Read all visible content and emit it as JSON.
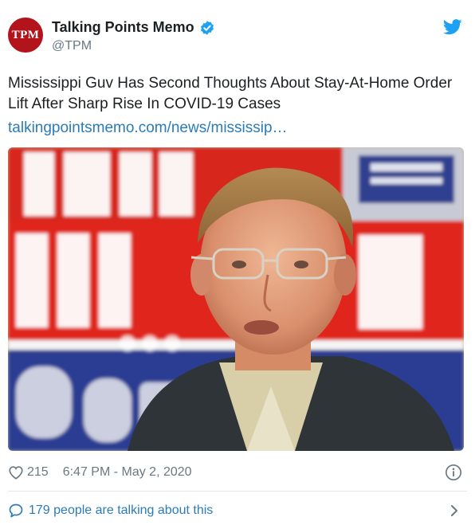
{
  "tweet": {
    "author": {
      "display_name": "Talking Points Memo",
      "handle": "@TPM",
      "avatar_text": "TPM",
      "verified": true
    },
    "text": "Mississippi Guv Has Second Thoughts About Stay-At-Home Order Lift After Sharp Rise In COVID-19 Cases",
    "link": "talkingpointsmemo.com/news/mississip…",
    "likes": "215",
    "timestamp": "6:47 PM - May 2, 2020",
    "conversation": "179 people are talking about this"
  },
  "icons": {
    "logo": "twitter-bird-icon",
    "verified": "verified-badge-icon",
    "like": "heart-icon",
    "info": "info-icon",
    "conversation": "speech-bubble-icon",
    "expand": "chevron-right-icon"
  },
  "colors": {
    "brand_blue": "#1da1f2",
    "link_blue": "#2b7bb9",
    "avatar_red": "#b3131b",
    "muted_text": "#697882",
    "divider": "#e1e8ed"
  }
}
